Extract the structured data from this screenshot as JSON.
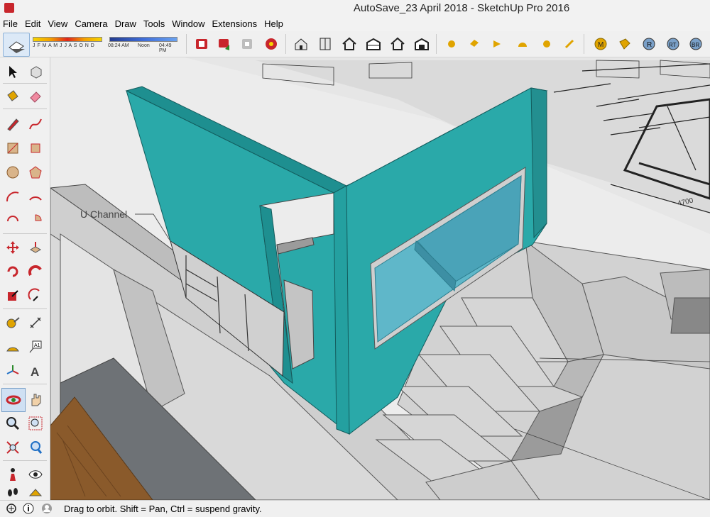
{
  "window": {
    "title": "AutoSave_23 April 2018 - SketchUp Pro 2016"
  },
  "menu": {
    "items": [
      "File",
      "Edit",
      "View",
      "Camera",
      "Draw",
      "Tools",
      "Window",
      "Extensions",
      "Help"
    ]
  },
  "toolbar": {
    "months": "J F M A M J J A S O N D",
    "time_start": "08:24 AM",
    "time_noon": "Noon",
    "time_end": "04:49 PM",
    "colors": {
      "accent": "#1f6fc5",
      "brand": "#c8262c"
    }
  },
  "viewport": {
    "label": "U Channel",
    "plan_dimension": "4700",
    "colors": {
      "wall": "#2aa9a9",
      "glass": "#5fb7c9",
      "surface": "#d7d7d7",
      "wood": "#8a5a2b"
    }
  },
  "status": {
    "text": "Drag to orbit. Shift = Pan, Ctrl = suspend gravity."
  }
}
